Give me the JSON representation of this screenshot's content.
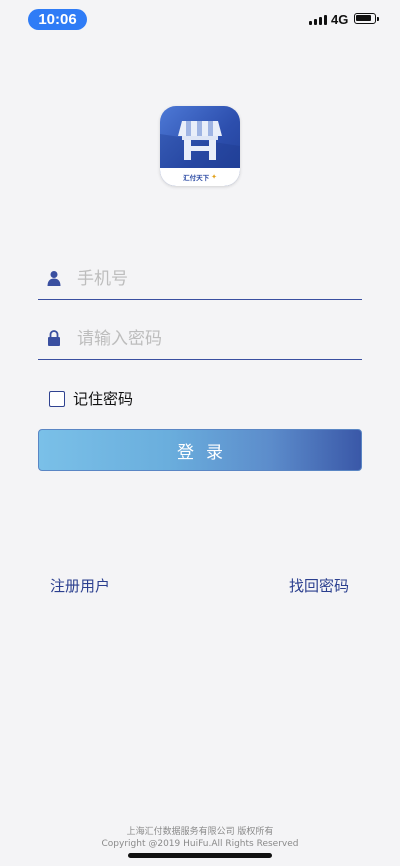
{
  "status_bar": {
    "time": "10:06",
    "network": "4G"
  },
  "logo": {
    "brand_text": "汇付天下"
  },
  "form": {
    "phone_placeholder": "手机号",
    "password_placeholder": "请输入密码",
    "remember_label": "记住密码",
    "remember_checked": false,
    "login_label": "登录"
  },
  "links": {
    "register": "注册用户",
    "forgot_password": "找回密码"
  },
  "footer": {
    "company": "上海汇付数据服务有限公司 版权所有",
    "copyright": "Copyright @2019 HuiFu.All Rights Reserved"
  },
  "colors": {
    "accent": "#2f7cf6",
    "primary": "#2b3f8f",
    "button_start": "#7ac0e8",
    "button_end": "#3a58a8"
  }
}
